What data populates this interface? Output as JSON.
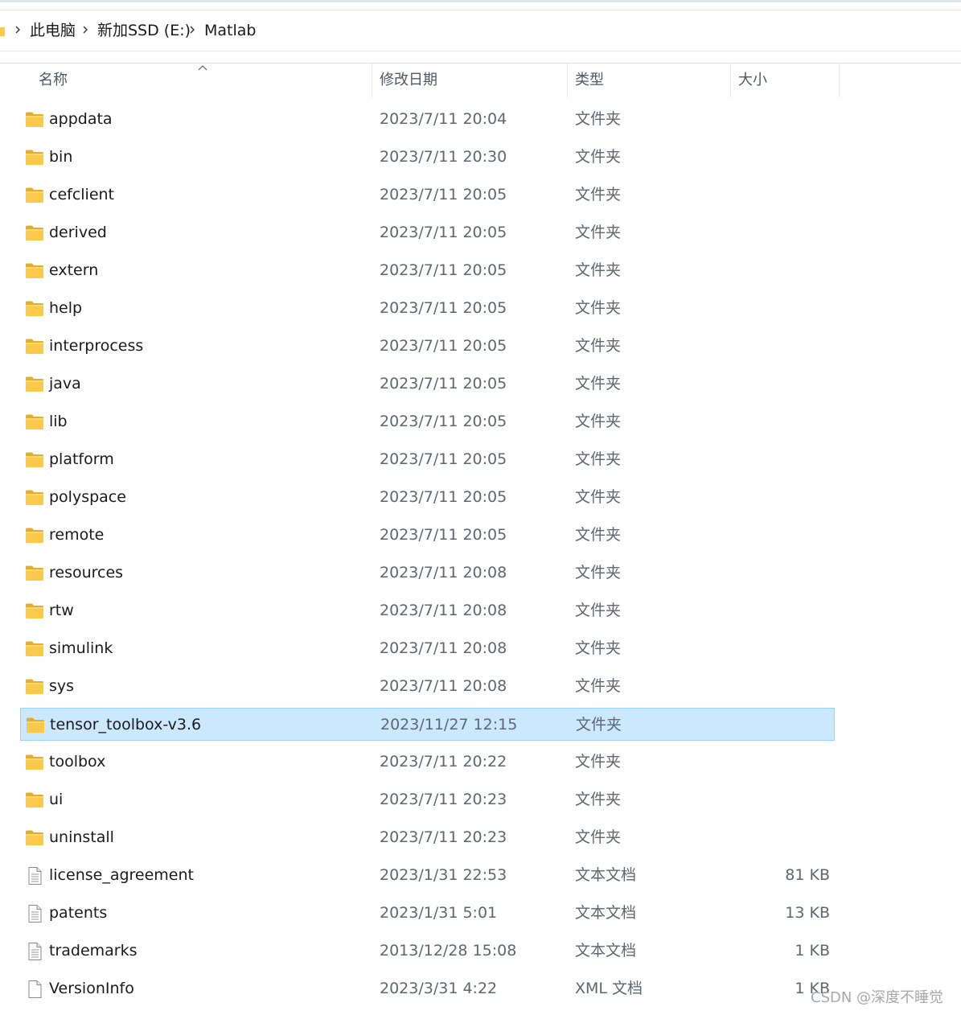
{
  "breadcrumb": {
    "items": [
      "此电脑",
      "新加SSD (E:)",
      "Matlab"
    ]
  },
  "columns": {
    "name": "名称",
    "date": "修改日期",
    "type": "类型",
    "size": "大小"
  },
  "files": [
    {
      "name": "appdata",
      "date": "2023/7/11 20:04",
      "type": "文件夹",
      "size": "",
      "icon": "folder-icon"
    },
    {
      "name": "bin",
      "date": "2023/7/11 20:30",
      "type": "文件夹",
      "size": "",
      "icon": "folder-icon"
    },
    {
      "name": "cefclient",
      "date": "2023/7/11 20:05",
      "type": "文件夹",
      "size": "",
      "icon": "folder-icon"
    },
    {
      "name": "derived",
      "date": "2023/7/11 20:05",
      "type": "文件夹",
      "size": "",
      "icon": "folder-icon"
    },
    {
      "name": "extern",
      "date": "2023/7/11 20:05",
      "type": "文件夹",
      "size": "",
      "icon": "folder-icon"
    },
    {
      "name": "help",
      "date": "2023/7/11 20:05",
      "type": "文件夹",
      "size": "",
      "icon": "folder-icon"
    },
    {
      "name": "interprocess",
      "date": "2023/7/11 20:05",
      "type": "文件夹",
      "size": "",
      "icon": "folder-icon"
    },
    {
      "name": "java",
      "date": "2023/7/11 20:05",
      "type": "文件夹",
      "size": "",
      "icon": "folder-icon"
    },
    {
      "name": "lib",
      "date": "2023/7/11 20:05",
      "type": "文件夹",
      "size": "",
      "icon": "folder-icon"
    },
    {
      "name": "platform",
      "date": "2023/7/11 20:05",
      "type": "文件夹",
      "size": "",
      "icon": "folder-icon"
    },
    {
      "name": "polyspace",
      "date": "2023/7/11 20:05",
      "type": "文件夹",
      "size": "",
      "icon": "folder-icon"
    },
    {
      "name": "remote",
      "date": "2023/7/11 20:05",
      "type": "文件夹",
      "size": "",
      "icon": "folder-icon"
    },
    {
      "name": "resources",
      "date": "2023/7/11 20:08",
      "type": "文件夹",
      "size": "",
      "icon": "folder-icon"
    },
    {
      "name": "rtw",
      "date": "2023/7/11 20:08",
      "type": "文件夹",
      "size": "",
      "icon": "folder-icon"
    },
    {
      "name": "simulink",
      "date": "2023/7/11 20:08",
      "type": "文件夹",
      "size": "",
      "icon": "folder-icon"
    },
    {
      "name": "sys",
      "date": "2023/7/11 20:08",
      "type": "文件夹",
      "size": "",
      "icon": "folder-icon"
    },
    {
      "name": "tensor_toolbox-v3.6",
      "date": "2023/11/27 12:15",
      "type": "文件夹",
      "size": "",
      "icon": "folder-icon",
      "selected": true
    },
    {
      "name": "toolbox",
      "date": "2023/7/11 20:22",
      "type": "文件夹",
      "size": "",
      "icon": "folder-icon"
    },
    {
      "name": "ui",
      "date": "2023/7/11 20:23",
      "type": "文件夹",
      "size": "",
      "icon": "folder-icon"
    },
    {
      "name": "uninstall",
      "date": "2023/7/11 20:23",
      "type": "文件夹",
      "size": "",
      "icon": "folder-icon"
    },
    {
      "name": "license_agreement",
      "date": "2023/1/31 22:53",
      "type": "文本文档",
      "size": "81 KB",
      "icon": "text-file-icon"
    },
    {
      "name": "patents",
      "date": "2023/1/31 5:01",
      "type": "文本文档",
      "size": "13 KB",
      "icon": "text-file-icon"
    },
    {
      "name": "trademarks",
      "date": "2013/12/28 15:08",
      "type": "文本文档",
      "size": "1 KB",
      "icon": "text-file-icon"
    },
    {
      "name": "VersionInfo",
      "date": "2023/3/31 4:22",
      "type": "XML 文档",
      "size": "1 KB",
      "icon": "xml-file-icon"
    }
  ],
  "watermark": "CSDN @深度不睡觉",
  "colors": {
    "selection_bg": "#cce8ff",
    "selection_border": "#99d1ff",
    "folder_yellow": "#f8c94a"
  }
}
